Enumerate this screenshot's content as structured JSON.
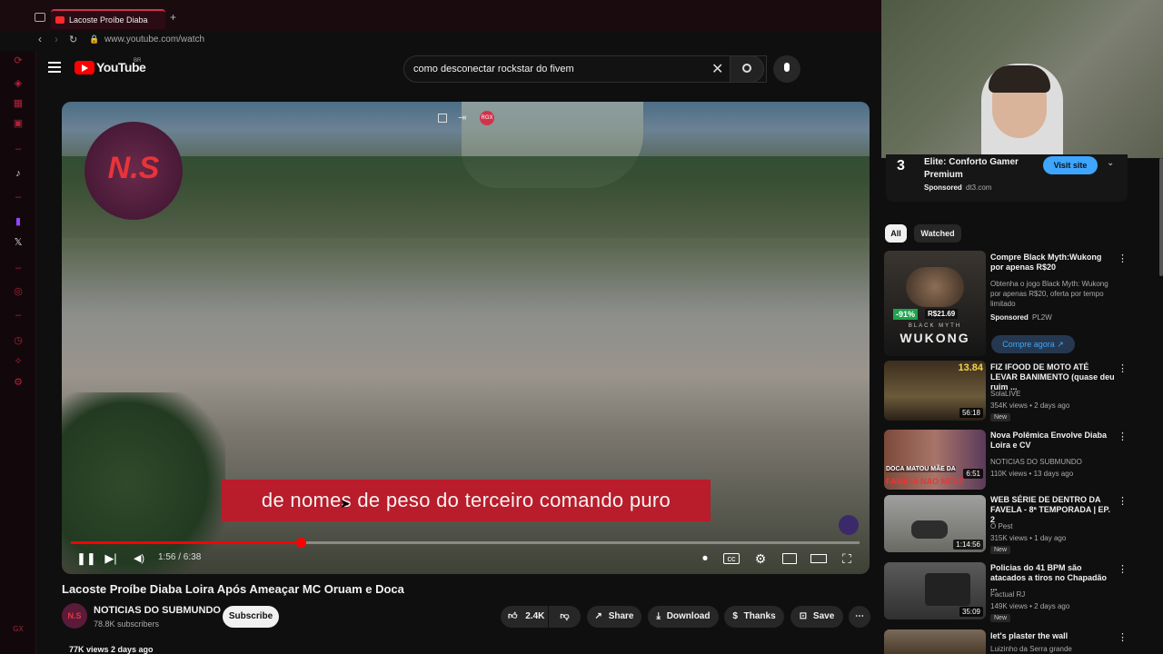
{
  "browser": {
    "tab_title": "Lacoste Proíbe Diaba",
    "url": "www.youtube.com/watch"
  },
  "youtube": {
    "logo_text": "YouTube",
    "country": "BR",
    "search_value": "como desconectar rockstar do fivem"
  },
  "video": {
    "subtitle": "de nomes de peso do terceiro comando puro",
    "watermark": "N.S",
    "current_time": "1:56",
    "duration": "6:38",
    "time_display": "1:56 / 6:38",
    "progress_fraction": 0.291,
    "overlay_badge": "RGX"
  },
  "meta": {
    "title": "Lacoste Proíbe Diaba Loira Após Ameaçar MC Oruam e Doca",
    "channel": "NOTICIAS DO SUBMUNDO",
    "channel_avatar": "N.S",
    "subscribers": "78.8K subscribers",
    "subscribe_label": "Subscribe",
    "likes": "2.4K",
    "share": "Share",
    "download": "Download",
    "thanks": "Thanks",
    "save": "Save",
    "views_date": "77K views  2 days ago"
  },
  "ad": {
    "title": "Elite: Conforto Gamer Premium",
    "sponsored": "Sponsored",
    "domain": "dt3.com",
    "cta": "Visit site"
  },
  "chips": [
    "All",
    "Watched"
  ],
  "recs": [
    {
      "title": "Compre Black Myth:Wukong por apenas R$20",
      "desc": "Obtenha o jogo Black Myth: Wukong por apenas R$20, oferta por tempo limitado",
      "channel": "PL2W",
      "sponsored": "Sponsored",
      "cta": "Compre agora",
      "thumb_text": "WUKONG",
      "thumb_sub": "BLACK MYTH",
      "discount": "-91%",
      "price": "R$21.69"
    },
    {
      "title": "FIZ IFOOD DE MOTO ATÉ LEVAR BANIMENTO (quase deu ruim ...",
      "channel": "SolaLIVE",
      "meta": "354K views • 2 days ago",
      "badge": "New",
      "duration": "56:18",
      "thumb_text": "13.84"
    },
    {
      "title": "Nova Polêmica Envolve Diaba Loira e CV",
      "channel": "NOTICIAS DO SUBMUNDO",
      "meta": "110K views • 13 days ago",
      "duration": "6:51",
      "thumb_text": "DOCA MATOU MÃE DA",
      "thumb_text2": "FAMILIA NAO MEXE"
    },
    {
      "title": "WEB SÉRIE DE DENTRO DA FAVELA - 8ª TEMPORADA | EP. 2",
      "channel": "O Pest",
      "meta": "315K views • 1 day ago",
      "badge": "New",
      "duration": "1:14:56"
    },
    {
      "title": "Policias do 41 BPM são atacados a tiros no Chapadão ...",
      "channel": "Factual RJ",
      "meta": "149K views • 2 days ago",
      "badge": "New",
      "duration": "35:09"
    },
    {
      "title": "let's plaster the wall",
      "channel": "Luizinho da Serra grande"
    }
  ]
}
